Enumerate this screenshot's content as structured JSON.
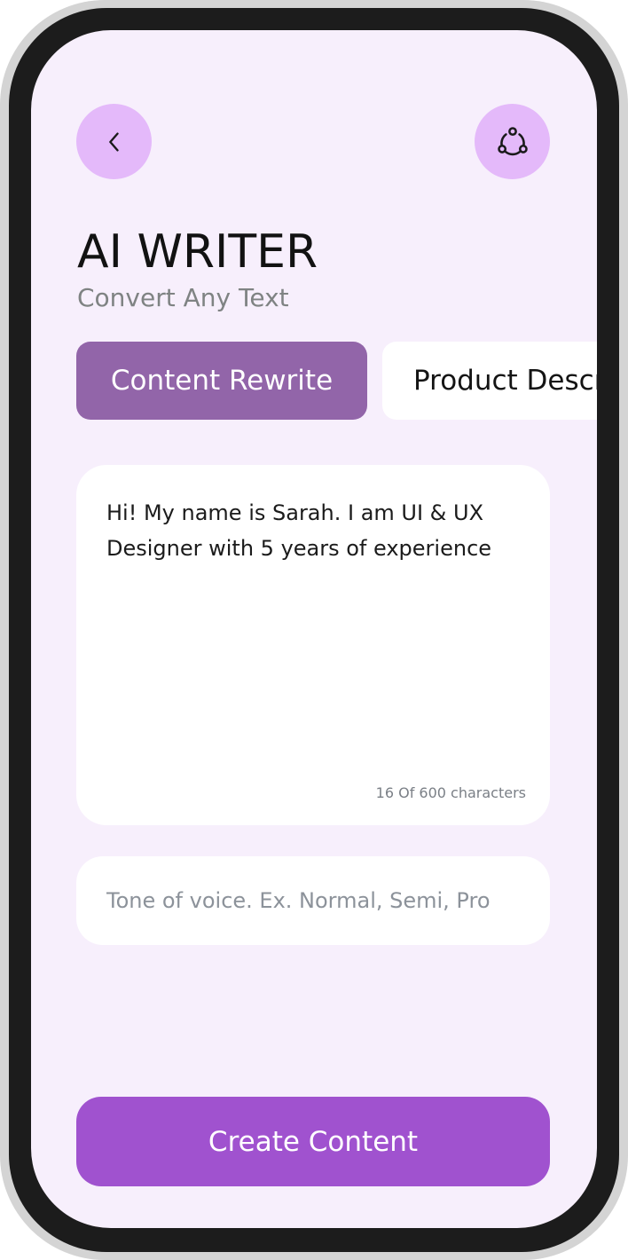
{
  "header": {
    "back_icon": "chevron-left-icon",
    "share_icon": "share-nodes-icon",
    "title": "AI WRITER",
    "subtitle": "Convert Any Text"
  },
  "tabs": [
    {
      "label": "Content Rewrite",
      "active": true
    },
    {
      "label": "Product Description",
      "active": false
    }
  ],
  "content": {
    "text": "Hi! My name is Sarah. I am UI & UX\nDesigner with 5 years of experience",
    "char_count": "16 Of 600 characters"
  },
  "tone": {
    "value": "",
    "placeholder": "Tone of voice. Ex. Normal, Semi, Pro"
  },
  "actions": {
    "create_label": "Create Content"
  },
  "colors": {
    "background": "#f7effc",
    "icon_button": "#e4b9fa",
    "active_tab": "#9265a9",
    "primary_button": "#a052cf"
  }
}
